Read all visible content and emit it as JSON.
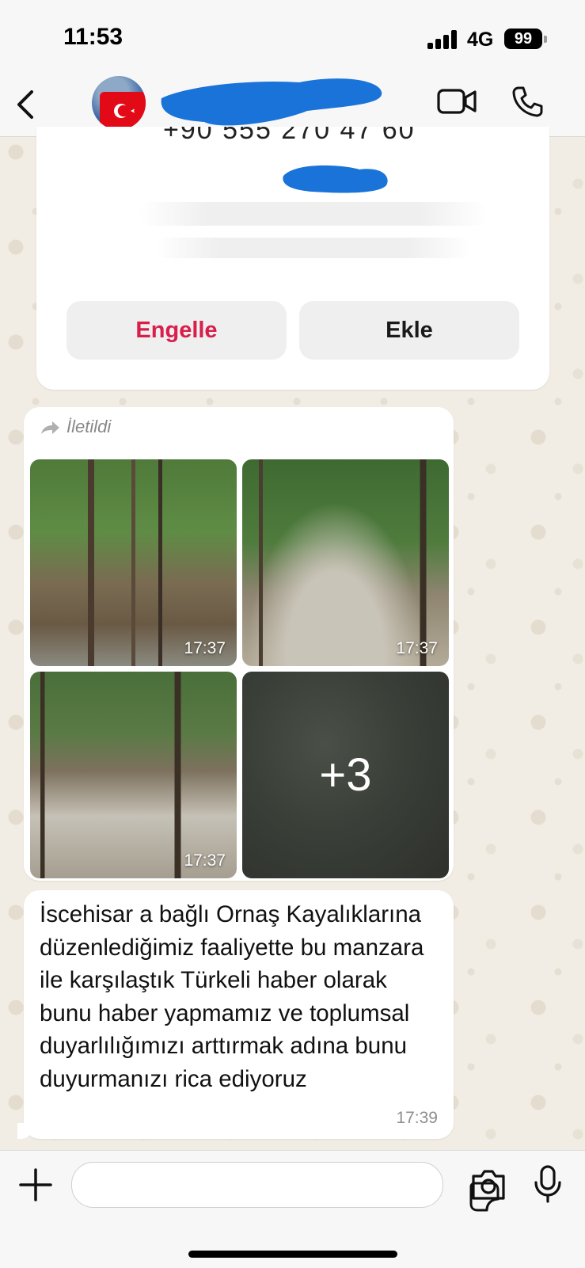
{
  "status": {
    "time": "11:53",
    "network": "4G",
    "battery": "99"
  },
  "header": {
    "back_icon": "chevron-left-icon"
  },
  "card": {
    "phone_partial": "+90 555 270 47 60",
    "block_label": "Engelle",
    "add_label": "Ekle"
  },
  "media": {
    "forwarded_label": "İletildi",
    "tiles": [
      {
        "time": "17:37"
      },
      {
        "time": "17:37"
      },
      {
        "time": "17:37"
      },
      {
        "more": "+3"
      }
    ]
  },
  "message": {
    "text": "İscehisar a bağlı Ornaş Kayalıklarına düzenlediğimiz faaliyette bu manzara ile karşılaştık Türkeli haber olarak bunu haber yapmamız ve toplumsal duyarlılığımızı arttırmak adına bunu duyurmanızı rica ediyoruz",
    "time": "17:39"
  },
  "colors": {
    "block_red": "#d81e4b",
    "redaction_blue": "#1a73d9"
  }
}
